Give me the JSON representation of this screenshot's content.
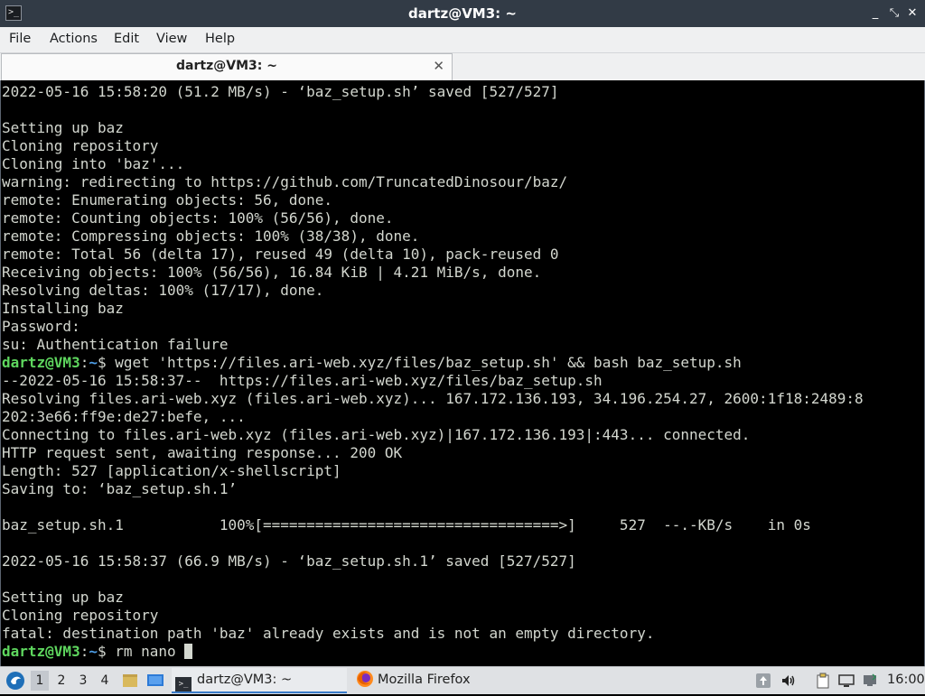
{
  "window": {
    "title": "dartz@VM3: ~"
  },
  "window_controls": {
    "minimize": "_",
    "maximize": "⤡",
    "close": "✕"
  },
  "menu": [
    "File",
    "Actions",
    "Edit",
    "View",
    "Help"
  ],
  "tab": {
    "label": "dartz@VM3: ~",
    "close": "✕"
  },
  "terminal": {
    "lines": [
      {
        "text": "2022-05-16 15:58:20 (51.2 MB/s) - ‘baz_setup.sh’ saved [527/527]"
      },
      {
        "text": ""
      },
      {
        "text": "Setting up baz"
      },
      {
        "text": "Cloning repository"
      },
      {
        "text": "Cloning into 'baz'..."
      },
      {
        "text": "warning: redirecting to https://github.com/TruncatedDinosour/baz/"
      },
      {
        "text": "remote: Enumerating objects: 56, done."
      },
      {
        "text": "remote: Counting objects: 100% (56/56), done."
      },
      {
        "text": "remote: Compressing objects: 100% (38/38), done."
      },
      {
        "text": "remote: Total 56 (delta 17), reused 49 (delta 10), pack-reused 0"
      },
      {
        "text": "Receiving objects: 100% (56/56), 16.84 KiB | 4.21 MiB/s, done."
      },
      {
        "text": "Resolving deltas: 100% (17/17), done."
      },
      {
        "text": "Installing baz"
      },
      {
        "text": "Password:"
      },
      {
        "text": "su: Authentication failure"
      },
      {
        "prompt": {
          "user": "dartz@VM3",
          "sep": ":",
          "path": "~",
          "sym": "$ "
        },
        "text": "wget 'https://files.ari-web.xyz/files/baz_setup.sh' && bash baz_setup.sh"
      },
      {
        "text": "--2022-05-16 15:58:37--  https://files.ari-web.xyz/files/baz_setup.sh"
      },
      {
        "text": "Resolving files.ari-web.xyz (files.ari-web.xyz)... 167.172.136.193, 34.196.254.27, 2600:1f18:2489:8"
      },
      {
        "text": "202:3e66:ff9e:de27:befe, ..."
      },
      {
        "text": "Connecting to files.ari-web.xyz (files.ari-web.xyz)|167.172.136.193|:443... connected."
      },
      {
        "text": "HTTP request sent, awaiting response... 200 OK"
      },
      {
        "text": "Length: 527 [application/x-shellscript]"
      },
      {
        "text": "Saving to: ‘baz_setup.sh.1’"
      },
      {
        "text": ""
      },
      {
        "text": "baz_setup.sh.1           100%[==================================>]     527  --.-KB/s    in 0s"
      },
      {
        "text": ""
      },
      {
        "text": "2022-05-16 15:58:37 (66.9 MB/s) - ‘baz_setup.sh.1’ saved [527/527]"
      },
      {
        "text": ""
      },
      {
        "text": "Setting up baz"
      },
      {
        "text": "Cloning repository"
      },
      {
        "text": "fatal: destination path 'baz' already exists and is not an empty directory."
      },
      {
        "prompt": {
          "user": "dartz@VM3",
          "sep": ":",
          "path": "~",
          "sym": "$ "
        },
        "text": "rm nano ",
        "cursor": true
      }
    ]
  },
  "taskbar": {
    "workspaces": [
      "1",
      "2",
      "3",
      "4"
    ],
    "active_workspace": "1",
    "tasks": [
      {
        "label": "dartz@VM3: ~",
        "icon": "terminal-icon",
        "active": true
      },
      {
        "label": "Mozilla Firefox",
        "icon": "firefox-icon",
        "active": false
      }
    ],
    "clock": "16:00"
  },
  "colors": {
    "titlebar": "#323b46",
    "terminal_bg": "#000000",
    "terminal_fg": "#d3d7cf",
    "prompt_user": "#5ed65e",
    "prompt_path": "#4e9fe8",
    "taskbar": "#dfe1e4"
  }
}
